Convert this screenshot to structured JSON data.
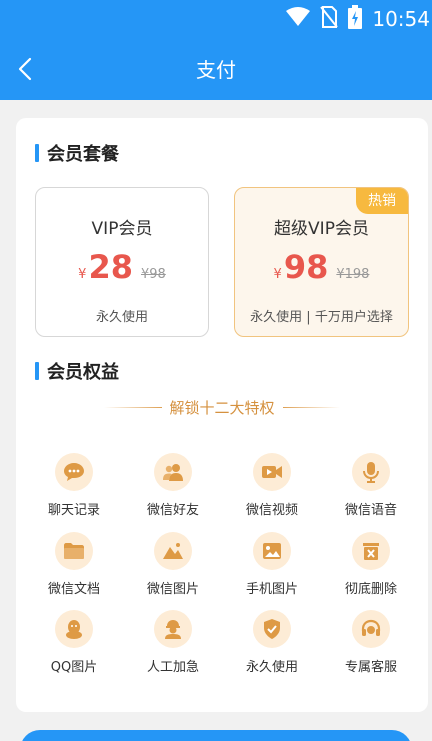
{
  "status_bar": {
    "time": "10:54"
  },
  "header": {
    "title": "支付"
  },
  "membership": {
    "section_title": "会员套餐",
    "plans": [
      {
        "name": "VIP会员",
        "currency": "¥",
        "price": "28",
        "original_price": "¥98",
        "desc": "永久使用",
        "badge": ""
      },
      {
        "name": "超级VIP会员",
        "currency": "¥",
        "price": "98",
        "original_price": "¥198",
        "desc": "永久使用 | 千万用户选择",
        "badge": "热销"
      }
    ]
  },
  "benefits": {
    "section_title": "会员权益",
    "subtitle": "解锁十二大特权",
    "items": [
      {
        "label": "聊天记录",
        "icon": "chat-bubble-icon"
      },
      {
        "label": "微信好友",
        "icon": "friends-icon"
      },
      {
        "label": "微信视频",
        "icon": "video-icon"
      },
      {
        "label": "微信语音",
        "icon": "microphone-icon"
      },
      {
        "label": "微信文档",
        "icon": "folder-icon"
      },
      {
        "label": "微信图片",
        "icon": "image-icon"
      },
      {
        "label": "手机图片",
        "icon": "phone-image-icon"
      },
      {
        "label": "彻底删除",
        "icon": "delete-icon"
      },
      {
        "label": "QQ图片",
        "icon": "qq-penguin-icon"
      },
      {
        "label": "人工加急",
        "icon": "worker-icon"
      },
      {
        "label": "永久使用",
        "icon": "shield-check-icon"
      },
      {
        "label": "专属客服",
        "icon": "headset-icon"
      }
    ]
  },
  "colors": {
    "primary": "#2596f6",
    "accent": "#dea053",
    "price": "#e8574d",
    "badge": "#f7b93f"
  }
}
